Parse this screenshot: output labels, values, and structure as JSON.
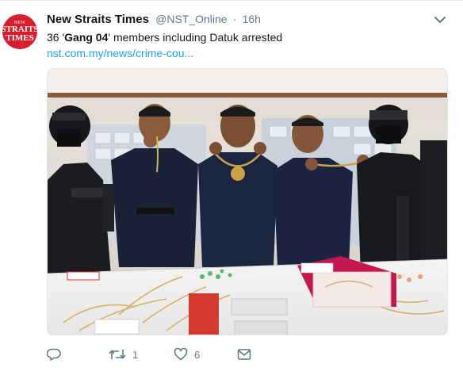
{
  "tweet": {
    "author_name": "New Straits Times",
    "handle": "@NST_Online",
    "separator": "·",
    "time": "16h",
    "text_prefix": "36 '",
    "text_bold": "Gang 04",
    "text_suffix": "' members including Datuk arrested",
    "link": "nst.com.my/news/crime-cou...",
    "avatar_text": [
      "NEW",
      "STRAITS",
      "TIMES"
    ],
    "retweet_count": "1",
    "like_count": "6"
  },
  "icons": {
    "more": "chevron-down-icon",
    "reply": "reply-icon",
    "retweet": "retweet-icon",
    "like": "heart-icon",
    "dm": "envelope-icon"
  },
  "colors": {
    "brand_red": "#d81e2c",
    "link_blue": "#1da1f2",
    "muted": "#657786"
  }
}
